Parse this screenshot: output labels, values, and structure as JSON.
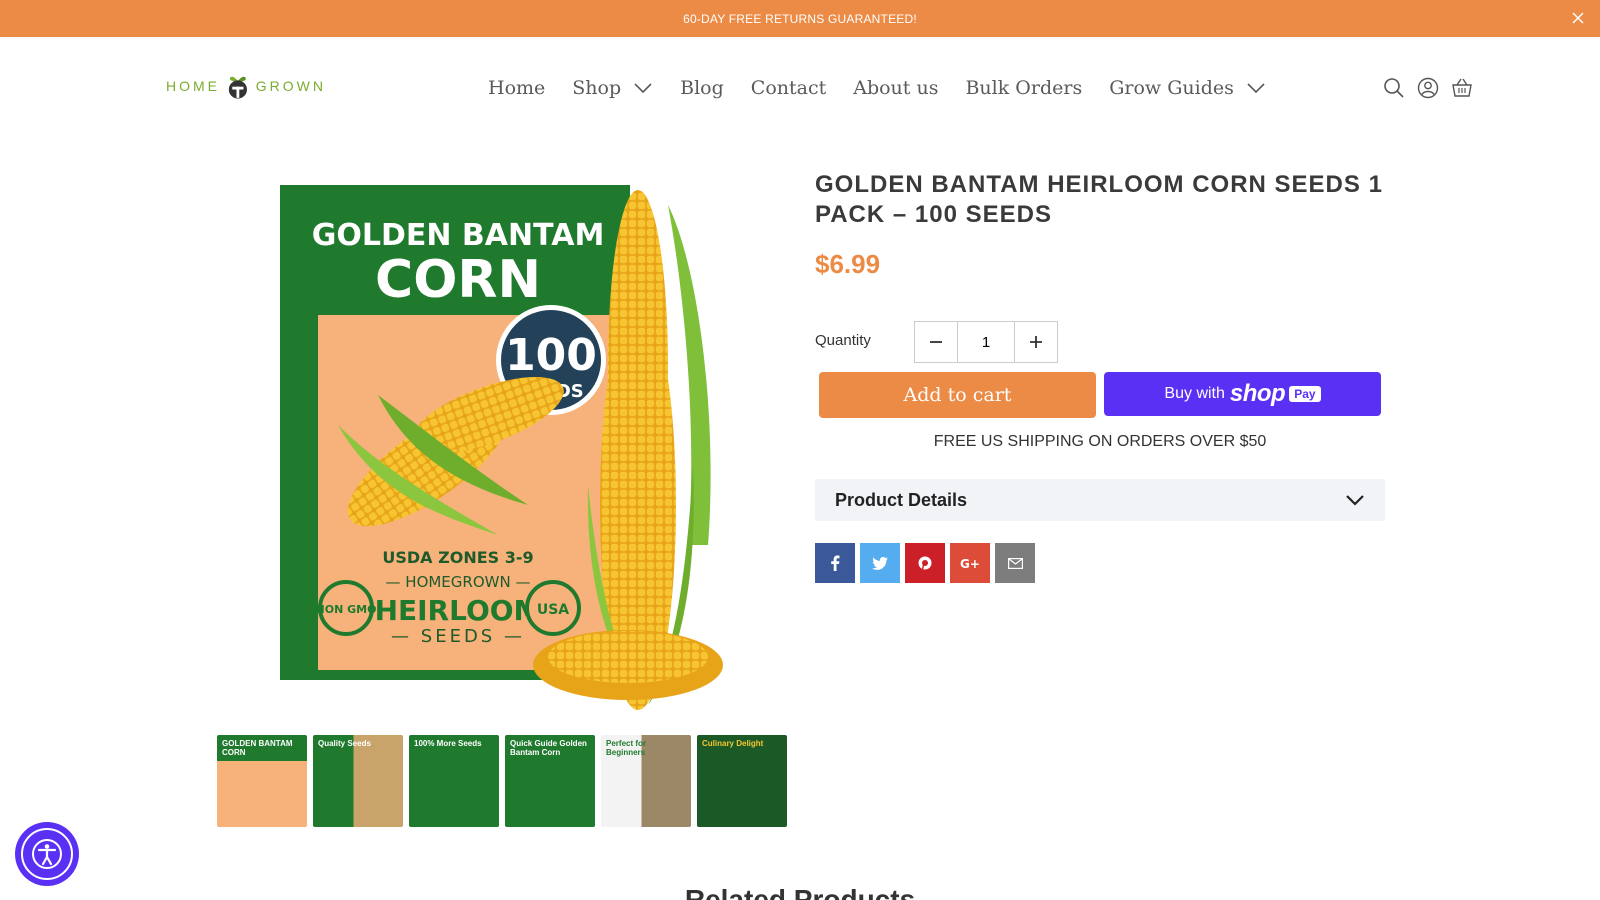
{
  "announcement": {
    "text": "60-DAY FREE RETURNS GUARANTEED!"
  },
  "logo": {
    "left": "HOME",
    "right": "GROWN"
  },
  "nav": {
    "items": [
      {
        "label": "Home"
      },
      {
        "label": "Shop"
      },
      {
        "label": "Blog"
      },
      {
        "label": "Contact"
      },
      {
        "label": "About us"
      },
      {
        "label": "Bulk Orders"
      },
      {
        "label": "Grow Guides"
      }
    ]
  },
  "product": {
    "title": "GOLDEN BANTAM HEIRLOOM CORN SEEDS 1 PACK – 100 SEEDS",
    "price": "$6.99",
    "quantity_label": "Quantity",
    "quantity": "1",
    "add_to_cart": "Add to cart",
    "buy_with": "Buy with",
    "shop": "shop",
    "pay": "Pay",
    "shipping": "FREE US SHIPPING ON ORDERS OVER $50",
    "details_label": "Product Details"
  },
  "packet": {
    "line1": "GOLDEN BANTAM",
    "line2": "CORN",
    "count": "100",
    "count_unit": "SEEDS",
    "zones": "USDA ZONES 3-9",
    "brand": "— HOMEGROWN —",
    "heirloom": "HEIRLOOM",
    "seeds": "— SEEDS —",
    "nongmo": "NON GMO",
    "usa": "USA"
  },
  "thumbnails": [
    {
      "caption": "GOLDEN BANTAM CORN"
    },
    {
      "caption": "Quality Seeds"
    },
    {
      "caption": "100% More Seeds"
    },
    {
      "caption": "Quick Guide Golden Bantam Corn"
    },
    {
      "caption": "Perfect for Beginners"
    },
    {
      "caption": "Culinary Delight"
    }
  ],
  "related_title": "Related Products",
  "colors": {
    "accent": "#ec8b46",
    "shop_pay": "#5a31f4",
    "logo_green": "#7bac2f",
    "packet_green": "#1f7a2e"
  }
}
